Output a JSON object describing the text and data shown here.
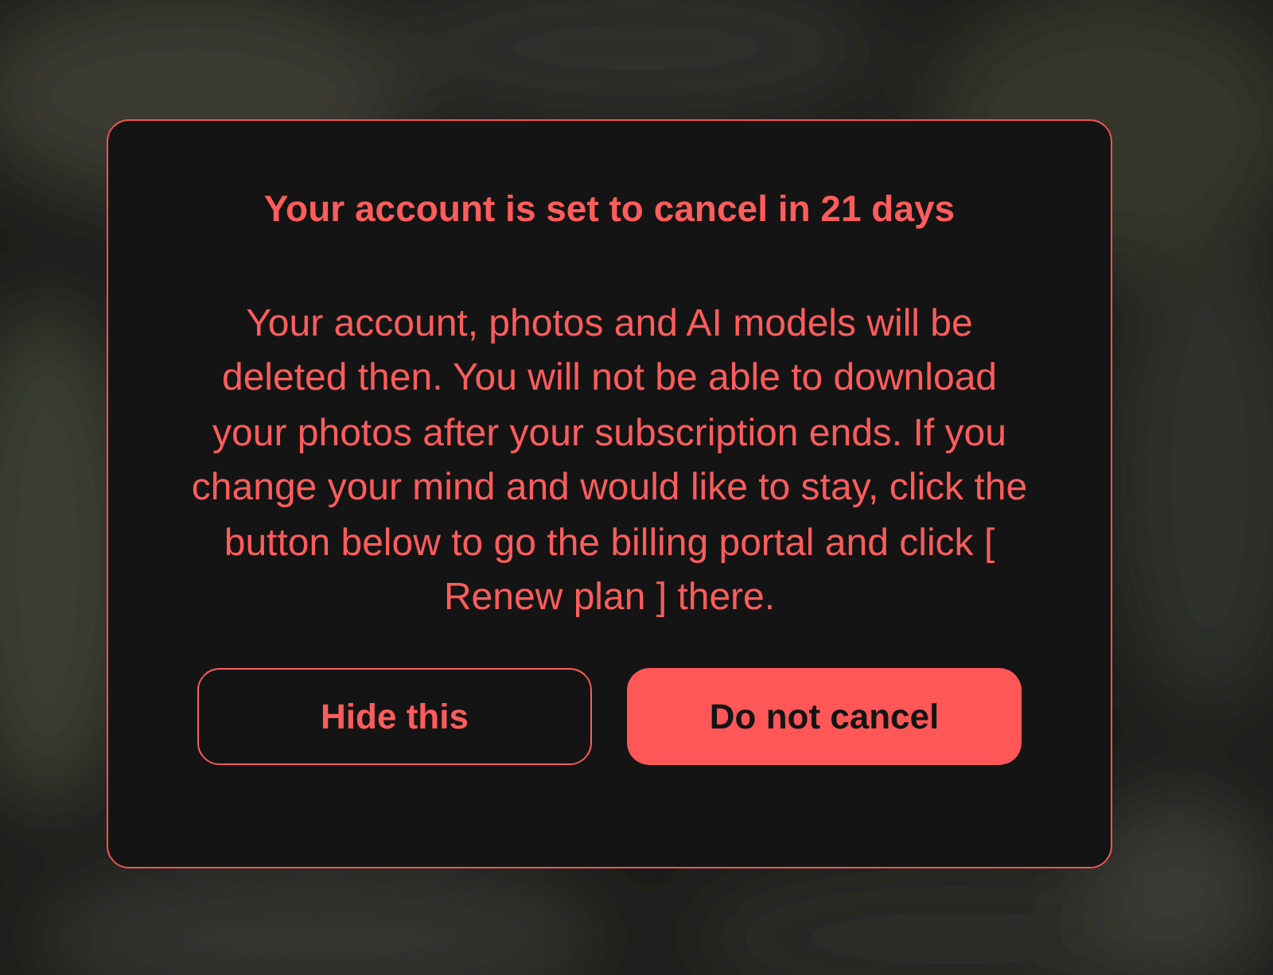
{
  "dialog": {
    "title": "Your account is set to cancel in 21 days",
    "message": "Your account, photos and AI models will be deleted then. You will not be able to download your photos after your subscription ends. If you change your mind and would like to stay, click the button below to go the billing portal and click [ Renew plan ] there.",
    "buttons": [
      {
        "label": "Hide this",
        "kind": "outline"
      },
      {
        "label": "Do not cancel",
        "kind": "filled"
      }
    ]
  }
}
